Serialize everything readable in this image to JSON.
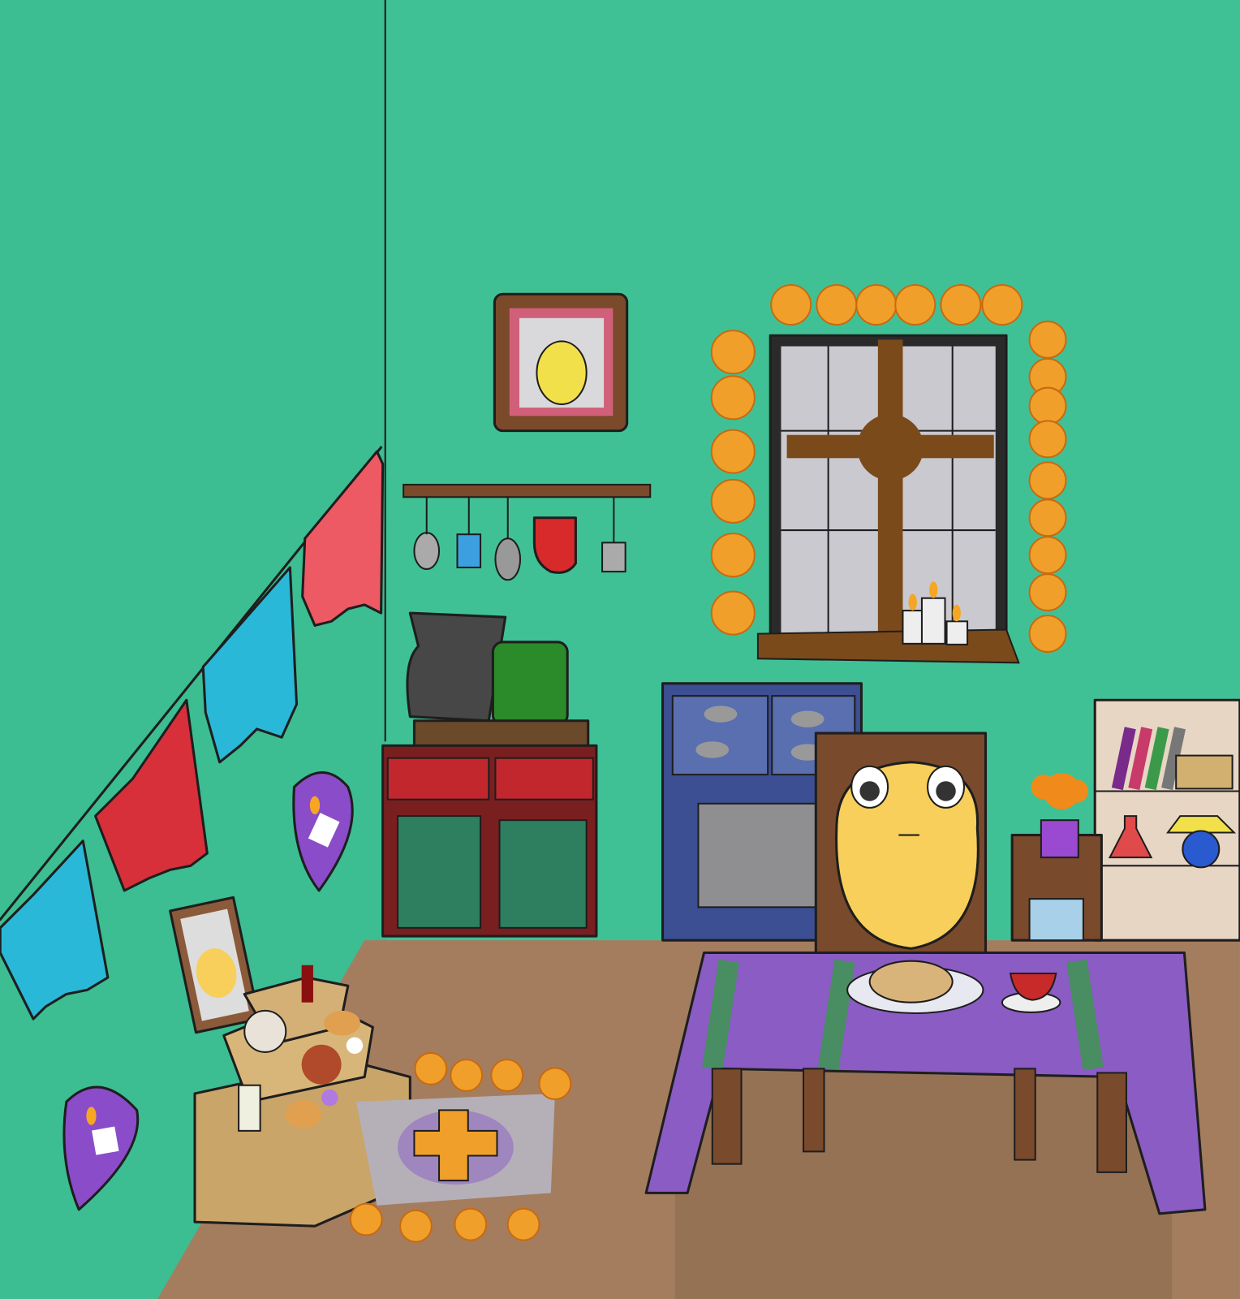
{
  "scene": {
    "subject": "dia-de-muertos-kitchen-illustration",
    "colors": {
      "wall_left": "#3cbd92",
      "wall_right": "#40c195",
      "floor": "#a47d5f",
      "marigold": "#f0a02a",
      "papel_red": "#d8303a",
      "papel_pink": "#ee5a64",
      "papel_blue": "#2ab8d8",
      "candle_purple": "#8a4cc8",
      "tablecloth": "#8a5cc4",
      "tablecloth_stripe": "#3a9a4a",
      "stove": "#3c4f92",
      "cabinet_red": "#9a1f24",
      "cabinet_green": "#2d7f5f",
      "chair": "#7a4a2c",
      "creature": "#f7cf5a",
      "window_glass": "#c9c9cf",
      "altar": "#c9a56a"
    },
    "icons": [
      "papel-picado-icon",
      "candle-icon",
      "marigold-icon",
      "portrait-icon",
      "pan-de-muerto-icon",
      "coffee-cup-icon",
      "sugar-skull-icon",
      "cross-icon",
      "book-icon",
      "lamp-icon"
    ]
  }
}
